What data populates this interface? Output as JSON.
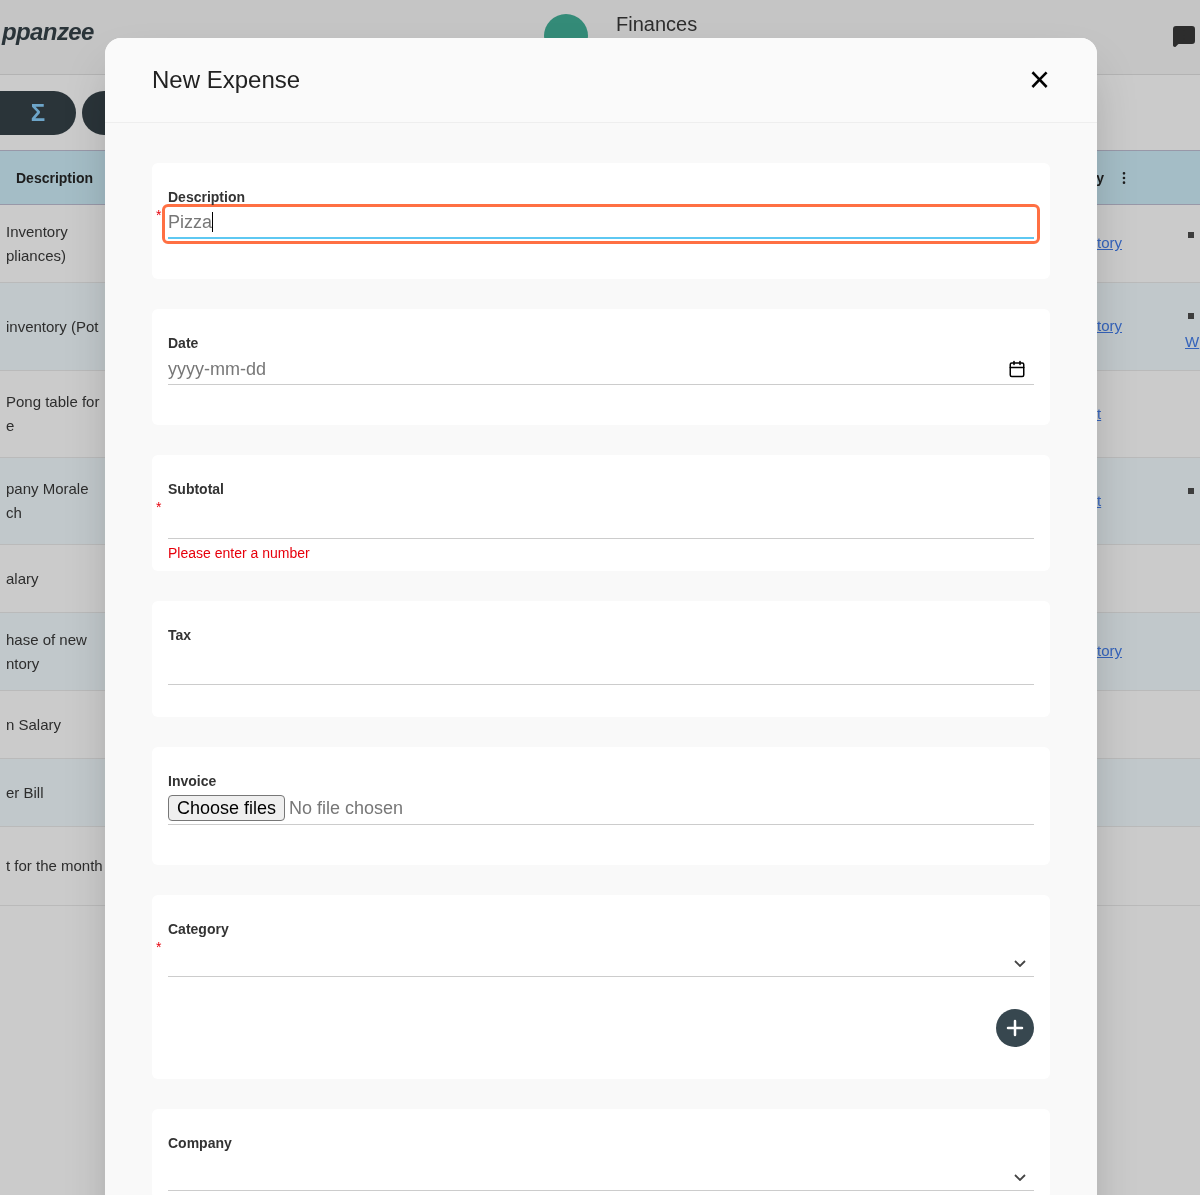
{
  "app": {
    "logo": "ppanzee",
    "section": "Finances"
  },
  "toolbar": {
    "buttons": [
      {
        "label": "Σ"
      }
    ]
  },
  "table": {
    "columns": [
      "Description",
      "y"
    ],
    "rows": [
      {
        "description": [
          "Inventory",
          "pliances)"
        ],
        "link": "tory",
        "marks": true,
        "extra": ""
      },
      {
        "description": [
          "inventory (Pot"
        ],
        "link": "tory",
        "marks": true,
        "extra": "W"
      },
      {
        "description": [
          "Pong table for",
          "e"
        ],
        "link": "t",
        "marks": false,
        "extra": ""
      },
      {
        "description": [
          "pany Morale",
          "ch"
        ],
        "link": "t",
        "marks": true,
        "extra": ""
      },
      {
        "description": [
          "alary"
        ],
        "link": "",
        "marks": false,
        "extra": ""
      },
      {
        "description": [
          "hase of new",
          "ntory"
        ],
        "link": "tory",
        "marks": false,
        "extra": ""
      },
      {
        "description": [
          "n Salary"
        ],
        "link": "",
        "marks": false,
        "extra": ""
      },
      {
        "description": [
          "er Bill"
        ],
        "link": "",
        "marks": false,
        "extra": ""
      },
      {
        "description": [
          "t for the month"
        ],
        "link": "",
        "marks": false,
        "extra": ""
      }
    ]
  },
  "dialog": {
    "title": "New Expense",
    "close": "×",
    "fields": [
      {
        "kind": "text",
        "label": "Description",
        "marker": "*",
        "value": "Pizza",
        "focused": true
      },
      {
        "kind": "date",
        "label": "Date",
        "placeholder": "yyyy-mm-dd"
      },
      {
        "kind": "number",
        "label": "Subtotal",
        "marker": "*",
        "error": "Please enter a number"
      },
      {
        "kind": "number",
        "label": "Tax"
      },
      {
        "kind": "file",
        "label": "Invoice",
        "button": "Choose files",
        "status": "No file chosen"
      },
      {
        "kind": "select",
        "label": "Category",
        "marker": "*",
        "add": true
      },
      {
        "kind": "select",
        "label": "Company"
      }
    ]
  }
}
